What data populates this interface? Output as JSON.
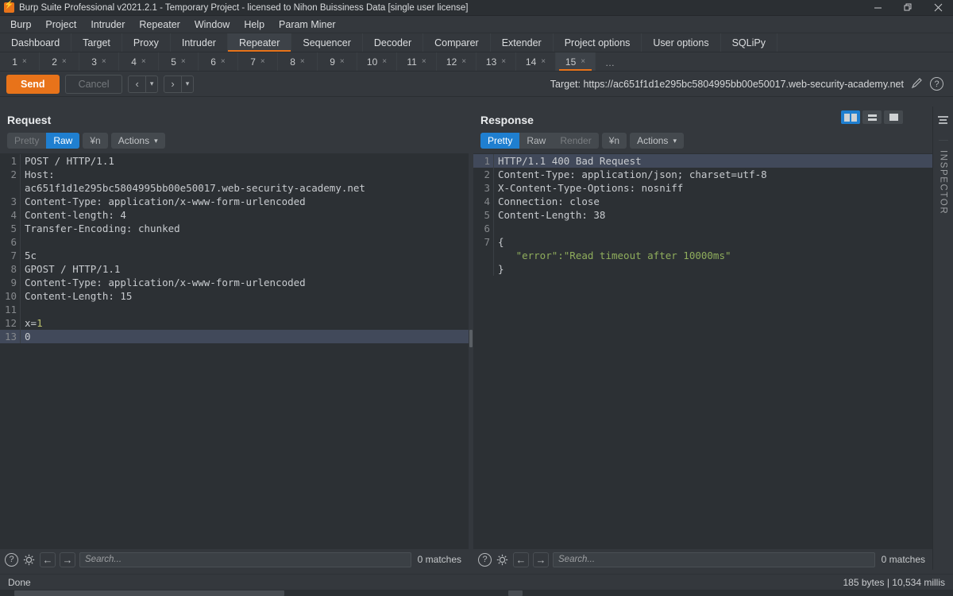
{
  "window": {
    "title": "Burp Suite Professional v2021.2.1 - Temporary Project - licensed to Nihon Buissiness Data [single user license]",
    "logo_icon": "burp-logo-icon",
    "controls": {
      "minimize": "minimize-icon",
      "restore": "restore-icon",
      "close": "close-icon"
    }
  },
  "menubar": {
    "items": [
      {
        "label": "Burp"
      },
      {
        "label": "Project"
      },
      {
        "label": "Intruder"
      },
      {
        "label": "Repeater"
      },
      {
        "label": "Window"
      },
      {
        "label": "Help"
      },
      {
        "label": "Param Miner"
      }
    ]
  },
  "main_tabs": {
    "selected": "Repeater",
    "items": [
      {
        "label": "Dashboard",
        "selected": false
      },
      {
        "label": "Target",
        "selected": false
      },
      {
        "label": "Proxy",
        "selected": false
      },
      {
        "label": "Intruder",
        "selected": false
      },
      {
        "label": "Repeater",
        "selected": true
      },
      {
        "label": "Sequencer",
        "selected": false
      },
      {
        "label": "Decoder",
        "selected": false
      },
      {
        "label": "Comparer",
        "selected": false
      },
      {
        "label": "Extender",
        "selected": false
      },
      {
        "label": "Project options",
        "selected": false
      },
      {
        "label": "User options",
        "selected": false
      },
      {
        "label": "SQLiPy",
        "selected": false
      }
    ]
  },
  "repeater_tabs": {
    "selected": "15",
    "close_glyph": "×",
    "overflow_label": "…",
    "items": [
      {
        "label": "1",
        "selected": false
      },
      {
        "label": "2",
        "selected": false
      },
      {
        "label": "3",
        "selected": false
      },
      {
        "label": "4",
        "selected": false
      },
      {
        "label": "5",
        "selected": false
      },
      {
        "label": "6",
        "selected": false
      },
      {
        "label": "7",
        "selected": false
      },
      {
        "label": "8",
        "selected": false
      },
      {
        "label": "9",
        "selected": false
      },
      {
        "label": "10",
        "selected": false
      },
      {
        "label": "11",
        "selected": false
      },
      {
        "label": "12",
        "selected": false
      },
      {
        "label": "13",
        "selected": false
      },
      {
        "label": "14",
        "selected": false
      },
      {
        "label": "15",
        "selected": true
      }
    ]
  },
  "toolbar": {
    "send_label": "Send",
    "cancel_label": "Cancel",
    "back_label": "‹",
    "forward_label": "›",
    "dropdown_glyph": "▾",
    "target_label": "Target: https://ac651f1d1e295bc5804995bb00e50017.web-security-academy.net",
    "edit_icon": "pencil-icon",
    "help_icon": "question-mark-icon",
    "help_glyph": "?"
  },
  "layout_buttons": {
    "selected": "side-by-side",
    "options": [
      {
        "name": "side-by-side",
        "selected": true
      },
      {
        "name": "stacked",
        "selected": false
      },
      {
        "name": "single",
        "selected": false
      }
    ]
  },
  "request": {
    "title": "Request",
    "tabs": [
      {
        "label": "Pretty",
        "selected": false,
        "disabled": true
      },
      {
        "label": "Raw",
        "selected": true,
        "disabled": false
      }
    ],
    "newline_label": "¥n",
    "actions_label": "Actions",
    "actions_caret": "▾",
    "lines": [
      {
        "no": "1",
        "text": "POST / HTTP/1.1",
        "highlight": false
      },
      {
        "no": "2",
        "text": "Host:",
        "highlight": false
      },
      {
        "no": "",
        "text": "ac651f1d1e295bc5804995bb00e50017.web-security-academy.net",
        "highlight": false
      },
      {
        "no": "3",
        "text": "Content-Type: application/x-www-form-urlencoded",
        "highlight": false
      },
      {
        "no": "4",
        "text": "Content-length: 4",
        "highlight": false
      },
      {
        "no": "5",
        "text": "Transfer-Encoding: chunked",
        "highlight": false
      },
      {
        "no": "6",
        "text": "",
        "highlight": false
      },
      {
        "no": "7",
        "text": "5c",
        "highlight": false
      },
      {
        "no": "8",
        "text": "GPOST / HTTP/1.1",
        "highlight": false
      },
      {
        "no": "9",
        "text": "Content-Type: application/x-www-form-urlencoded",
        "highlight": false
      },
      {
        "no": "10",
        "text": "Content-Length: 15",
        "highlight": false
      },
      {
        "no": "11",
        "text": "",
        "highlight": false
      },
      {
        "no": "12",
        "text": "x=1",
        "highlight": false
      },
      {
        "no": "13",
        "text": "0",
        "highlight": true
      }
    ],
    "search": {
      "placeholder": "Search...",
      "value": "",
      "matches_label": "0 matches",
      "help_glyph": "?",
      "gear_icon": "gear-icon",
      "prev_glyph": "←",
      "next_glyph": "→"
    }
  },
  "response": {
    "title": "Response",
    "tabs": [
      {
        "label": "Pretty",
        "selected": true,
        "disabled": false
      },
      {
        "label": "Raw",
        "selected": false,
        "disabled": false
      },
      {
        "label": "Render",
        "selected": false,
        "disabled": true
      }
    ],
    "newline_label": "¥n",
    "actions_label": "Actions",
    "actions_caret": "▾",
    "lines": [
      {
        "no": "1",
        "text": "HTTP/1.1 400 Bad Request",
        "highlight": true
      },
      {
        "no": "2",
        "text": "Content-Type: application/json; charset=utf-8",
        "highlight": false
      },
      {
        "no": "3",
        "text": "X-Content-Type-Options: nosniff",
        "highlight": false
      },
      {
        "no": "4",
        "text": "Connection: close",
        "highlight": false
      },
      {
        "no": "5",
        "text": "Content-Length: 38",
        "highlight": false
      },
      {
        "no": "6",
        "text": "",
        "highlight": false
      },
      {
        "no": "7",
        "text": "{",
        "highlight": false
      },
      {
        "no": "",
        "text": "   \"error\":\"Read timeout after 10000ms\"",
        "highlight": false,
        "style": "string"
      },
      {
        "no": "",
        "text": "}",
        "highlight": false
      }
    ],
    "search": {
      "placeholder": "Search...",
      "value": "",
      "matches_label": "0 matches",
      "help_glyph": "?",
      "gear_icon": "gear-icon",
      "prev_glyph": "←",
      "next_glyph": "→"
    }
  },
  "inspector": {
    "label": "INSPECTOR",
    "icon": "panel-collapse-icon"
  },
  "statusbar": {
    "left_text": "Done",
    "right_text": "185 bytes | 10,534 millis"
  },
  "colors": {
    "accent_orange": "#e8731a",
    "accent_blue": "#1f7fd0",
    "panel_bg": "#34383d",
    "editor_bg": "#2c3034",
    "string_green": "#8fad5c",
    "number_yellow": "#bcc26b",
    "current_line": "#41495a"
  }
}
